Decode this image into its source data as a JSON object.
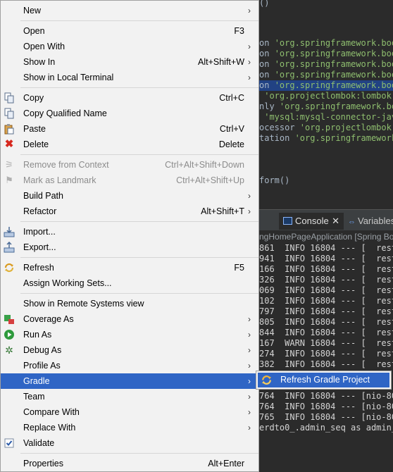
{
  "editor": {
    "lines": [
      {
        "pre": "()",
        "str": ""
      },
      {
        "pre": "on ",
        "str": "'org.springframework.boo"
      },
      {
        "pre": "on ",
        "str": "'org.springframework.boo"
      },
      {
        "pre": "on ",
        "str": "'org.springframework.boo"
      },
      {
        "pre": "on ",
        "str": "'org.springframework.boo"
      },
      {
        "pre": "on ",
        "str": "'org.springframework.boo"
      },
      {
        "pre": " ",
        "str": "'org.projectlombok:lombok'"
      },
      {
        "pre": "nly ",
        "str": "'org.springframework.boo"
      },
      {
        "pre": " ",
        "str": "'mysql:mysql-connector-java"
      },
      {
        "pre": "ocessor ",
        "str": "'org.projectlombok:"
      },
      {
        "pre": "tation ",
        "str": "'org.springframework"
      },
      {
        "pre": "form()",
        "str": ""
      }
    ]
  },
  "console": {
    "tab_label": "Console",
    "tab_close": "✕",
    "variables_label": "Variables",
    "title": "ngHomePageApplication [Spring Boo",
    "lines": [
      "861  INFO 16804 --- [  rest",
      "941  INFO 16804 --- [  rest",
      "166  INFO 16804 --- [  rest",
      "326  INFO 16804 --- [  rest",
      "069  INFO 16804 --- [  rest",
      "102  INFO 16804 --- [  rest",
      "797  INFO 16804 --- [  rest",
      "805  INFO 16804 --- [  rest",
      "844  INFO 16804 --- [  rest",
      "167  WARN 16804 --- [  rest",
      "274  INFO 16804 --- [  rest",
      "382  INFO 16804 --- [  rest",
      "",
      "",
      "764  INFO 16804 --- [nio-80",
      "764  INFO 16804 --- [nio-80",
      "765  INFO 16804 --- [nio-80",
      "erdto0_.admin_seq as admin_"
    ]
  },
  "menu": {
    "new": "New",
    "open": "Open",
    "open_sc": "F3",
    "open_with": "Open With",
    "show_in": "Show In",
    "show_in_sc": "Alt+Shift+W",
    "show_in_local_terminal": "Show in Local Terminal",
    "copy": "Copy",
    "copy_sc": "Ctrl+C",
    "copy_qualified_name": "Copy Qualified Name",
    "paste": "Paste",
    "paste_sc": "Ctrl+V",
    "delete": "Delete",
    "delete_sc": "Delete",
    "remove_from_context": "Remove from Context",
    "remove_from_context_sc": "Ctrl+Alt+Shift+Down",
    "mark_as_landmark": "Mark as Landmark",
    "mark_as_landmark_sc": "Ctrl+Alt+Shift+Up",
    "build_path": "Build Path",
    "refactor": "Refactor",
    "refactor_sc": "Alt+Shift+T",
    "import": "Import...",
    "export": "Export...",
    "refresh": "Refresh",
    "refresh_sc": "F5",
    "assign_working_sets": "Assign Working Sets...",
    "show_in_remote_systems_view": "Show in Remote Systems view",
    "coverage_as": "Coverage As",
    "run_as": "Run As",
    "debug_as": "Debug As",
    "profile_as": "Profile As",
    "gradle": "Gradle",
    "team": "Team",
    "compare_with": "Compare With",
    "replace_with": "Replace With",
    "validate": "Validate",
    "properties": "Properties",
    "properties_sc": "Alt+Enter"
  },
  "submenu": {
    "refresh_gradle_project": "Refresh Gradle Project"
  },
  "colors": {
    "menu_bg": "#f2f2f2",
    "highlight": "#2f65c5",
    "editor_bg": "#2b2b2b",
    "string": "#8fbf6f"
  }
}
